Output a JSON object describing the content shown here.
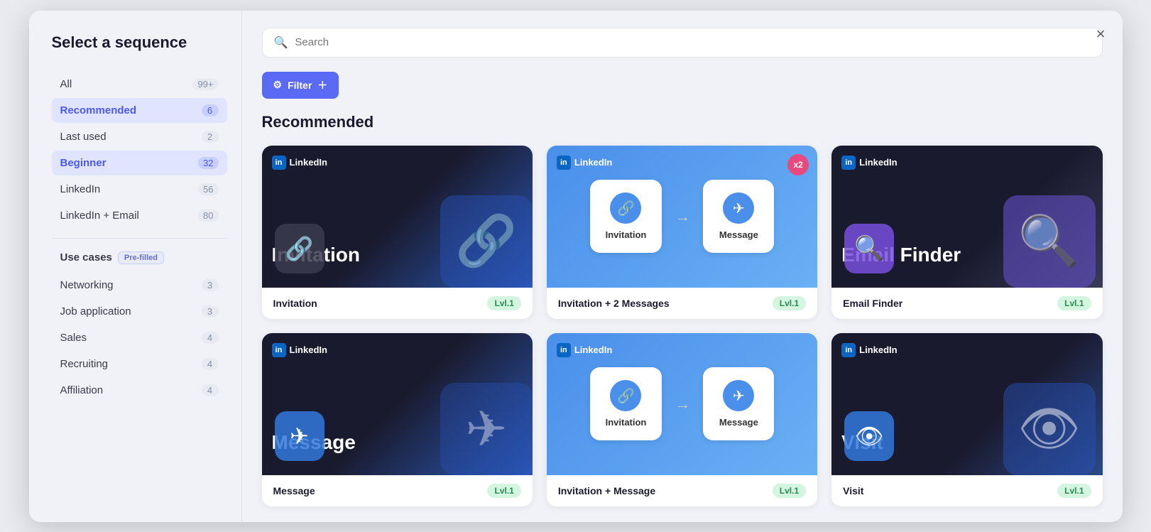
{
  "modal": {
    "title": "Select a sequence",
    "close_label": "×"
  },
  "sidebar": {
    "items": [
      {
        "id": "all",
        "label": "All",
        "count": "99+",
        "active": false
      },
      {
        "id": "recommended",
        "label": "Recommended",
        "count": "6",
        "active": true
      },
      {
        "id": "last-used",
        "label": "Last used",
        "count": "2",
        "active": false
      },
      {
        "id": "beginner",
        "label": "Beginner",
        "count": "32",
        "active": true
      },
      {
        "id": "linkedin",
        "label": "LinkedIn",
        "count": "56",
        "active": false
      },
      {
        "id": "linkedin-email",
        "label": "LinkedIn + Email",
        "count": "80",
        "active": false
      }
    ],
    "use_cases_label": "Use cases",
    "pre_filled_badge": "Pre-filled",
    "use_case_items": [
      {
        "id": "networking",
        "label": "Networking",
        "count": "3"
      },
      {
        "id": "job-application",
        "label": "Job application",
        "count": "3"
      },
      {
        "id": "sales",
        "label": "Sales",
        "count": "4"
      },
      {
        "id": "recruiting",
        "label": "Recruiting",
        "count": "4"
      },
      {
        "id": "affiliation",
        "label": "Affiliation",
        "count": "4"
      }
    ]
  },
  "search": {
    "placeholder": "Search"
  },
  "filter_btn": "Filter",
  "section_title": "Recommended",
  "cards": [
    {
      "id": "invitation",
      "name": "Invitation",
      "level": "Lvl.1",
      "type": "single",
      "theme": "dark-blue"
    },
    {
      "id": "invitation-2-messages",
      "name": "Invitation + 2 Messages",
      "level": "Lvl.1",
      "type": "flow",
      "theme": "light-blue"
    },
    {
      "id": "email-finder",
      "name": "Email Finder",
      "level": "Lvl.1",
      "type": "single",
      "theme": "dark"
    },
    {
      "id": "message",
      "name": "Message",
      "level": "Lvl.1",
      "type": "single",
      "theme": "dark-blue"
    },
    {
      "id": "invitation-message",
      "name": "Invitation + Message",
      "level": "Lvl.1",
      "type": "flow",
      "theme": "light-blue"
    },
    {
      "id": "visit",
      "name": "Visit",
      "level": "Lvl.1",
      "type": "single",
      "theme": "dark"
    }
  ],
  "icons": {
    "search": "🔍",
    "filter": "⚙",
    "close": "✕",
    "linkedin": "in",
    "link": "🔗",
    "message": "✈",
    "eye": "👁",
    "search_symbol": "🔍",
    "invitation_flow": "🔗",
    "arrow": "→"
  }
}
